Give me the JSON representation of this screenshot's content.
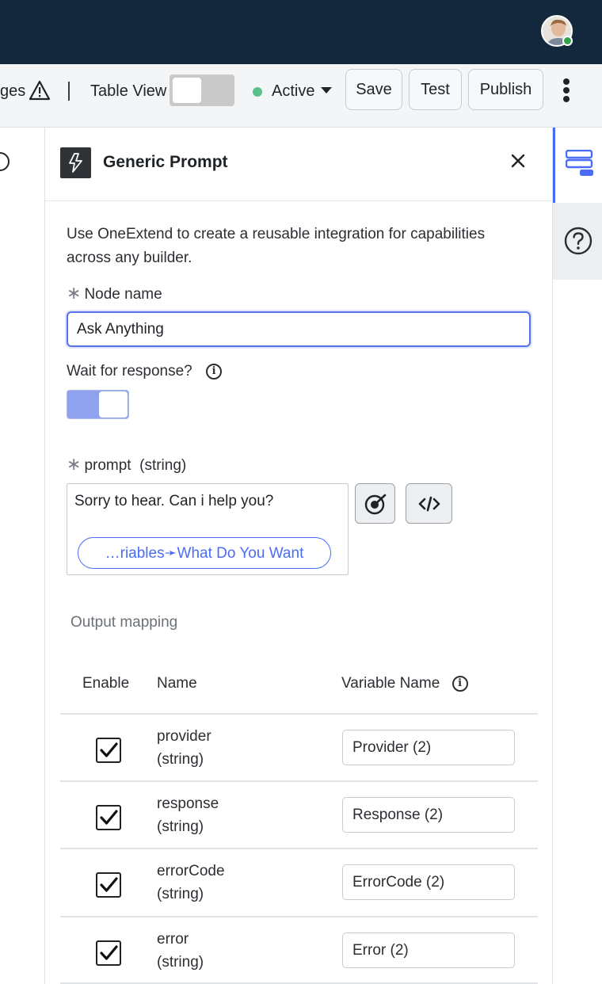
{
  "toolbar": {
    "messages_fragment": "ges",
    "table_view_label": "Table View",
    "status_label": "Active",
    "save_label": "Save",
    "test_label": "Test",
    "publish_label": "Publish"
  },
  "panel": {
    "title": "Generic Prompt",
    "description": "Use OneExtend to create a reusable integration for capabilities across any builder.",
    "node_name_label": "Node name",
    "node_name_value": "Ask Anything",
    "wait_label": "Wait for response?",
    "prompt_label": "prompt  (string)",
    "prompt_text": "Sorry to hear. Can i help you?",
    "variable_chip": "…riables➛What Do You Want",
    "output_mapping_title": "Output mapping",
    "columns": {
      "enable": "Enable",
      "name": "Name",
      "variable_name": "Variable Name"
    },
    "rows": [
      {
        "name": "provider",
        "type": "(string)",
        "variable": "Provider (2)",
        "enabled": true
      },
      {
        "name": "response",
        "type": "(string)",
        "variable": "Response (2)",
        "enabled": true
      },
      {
        "name": "errorCode",
        "type": "(string)",
        "variable": "ErrorCode (2)",
        "enabled": true
      },
      {
        "name": "error",
        "type": "(string)",
        "variable": "Error (2)",
        "enabled": true
      }
    ]
  },
  "icons": {
    "warning": "warning-icon",
    "node": "lightning-icon",
    "close": "close-icon",
    "ai": "ai-target-icon",
    "code": "code-icon",
    "nodes_rail": "stack-icon",
    "help": "help-icon",
    "info": "info-icon"
  },
  "colors": {
    "topbar": "#13283d",
    "accent": "#4a6cf7",
    "status_active": "#5cc08a"
  }
}
